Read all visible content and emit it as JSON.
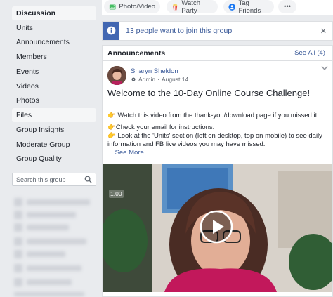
{
  "sidebar": {
    "items": [
      {
        "label": "Discussion"
      },
      {
        "label": "Units"
      },
      {
        "label": "Announcements"
      },
      {
        "label": "Members"
      },
      {
        "label": "Events"
      },
      {
        "label": "Videos"
      },
      {
        "label": "Photos"
      },
      {
        "label": "Files"
      },
      {
        "label": "Group Insights"
      },
      {
        "label": "Moderate Group"
      },
      {
        "label": "Group Quality"
      }
    ],
    "search_placeholder": "Search this group"
  },
  "actions": {
    "photo_video": "Photo/Video",
    "watch_party": "Watch Party",
    "tag_friends": "Tag Friends",
    "more": "•••"
  },
  "join_banner": {
    "text": "13 people want to join this group"
  },
  "announcements": {
    "title": "Announcements",
    "see_all": "See All (4)",
    "post": {
      "author": "Sharyn Sheldon",
      "role": "Admin",
      "date": "August 14",
      "title": "Welcome to the 10-Day Online Course Challenge!",
      "line1": "Watch this video from the thank-you/download page if you missed it.",
      "line2": "Check your email for instructions.",
      "line3": "Look at the 'Units' section (left on desktop, top on mobile) to see daily information and FB live videos you may have missed.",
      "ellipsis": "...",
      "see_more": "See More",
      "video_speed": "1.00"
    }
  },
  "colors": {
    "brand": "#4267b2",
    "link": "#385898",
    "bg": "#e9ebee"
  }
}
